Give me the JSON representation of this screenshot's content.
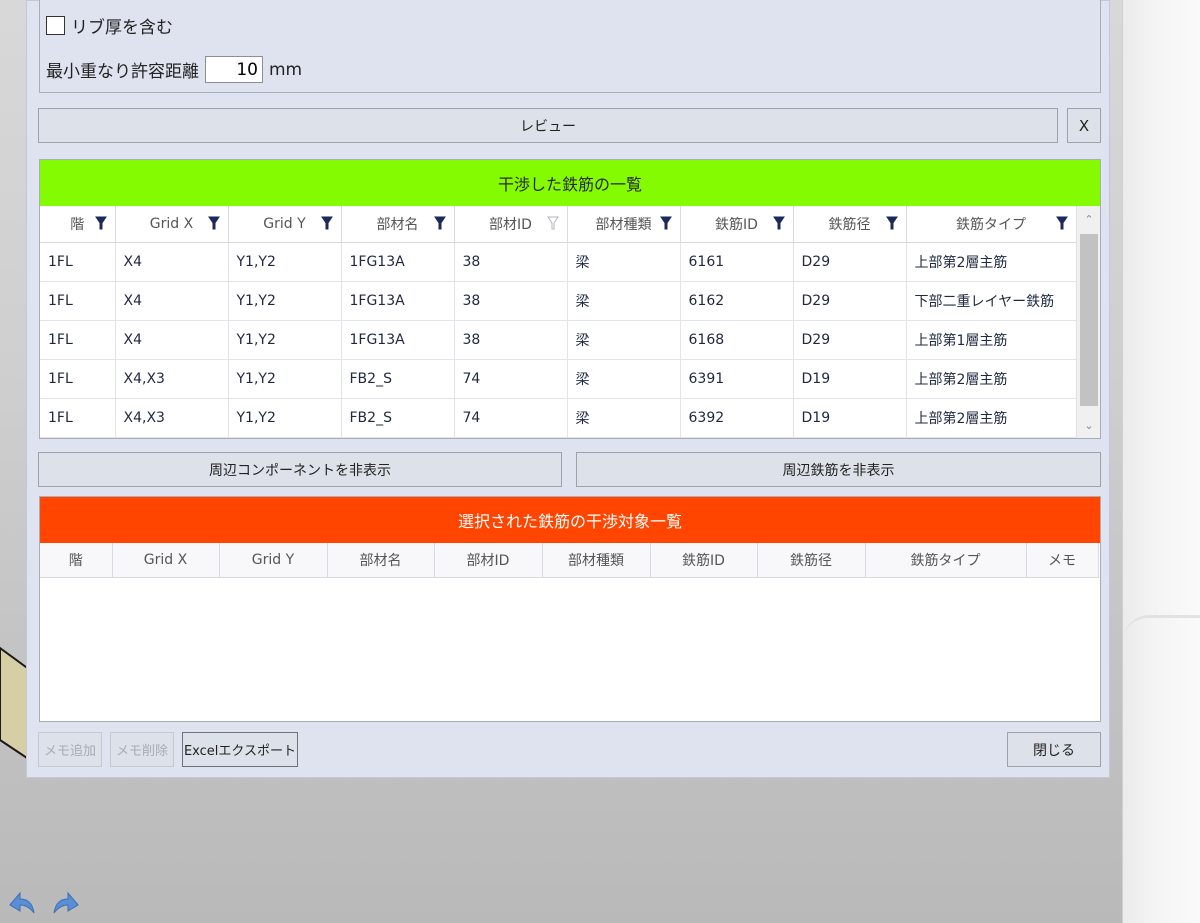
{
  "settings": {
    "rib_checkbox_label": "リブ厚を含む",
    "rib_checked": false,
    "min_distance_label": "最小重なり許容距離",
    "min_distance_value": "10",
    "min_distance_unit": "mm"
  },
  "review_label": "レビュー",
  "close_x_label": "X",
  "interference": {
    "title": "干渉した鉄筋の一覧",
    "header_color": "#84fb00",
    "columns": [
      "階",
      "Grid X",
      "Grid Y",
      "部材名",
      "部材ID",
      "部材種類",
      "鉄筋ID",
      "鉄筋径",
      "鉄筋タイプ"
    ],
    "rows": [
      [
        "1FL",
        "X4",
        "Y1,Y2",
        "1FG13A",
        "38",
        "梁",
        "6161",
        "D29",
        "上部第2層主筋"
      ],
      [
        "1FL",
        "X4",
        "Y1,Y2",
        "1FG13A",
        "38",
        "梁",
        "6162",
        "D29",
        "下部二重レイヤー鉄筋"
      ],
      [
        "1FL",
        "X4",
        "Y1,Y2",
        "1FG13A",
        "38",
        "梁",
        "6168",
        "D29",
        "上部第1層主筋"
      ],
      [
        "1FL",
        "X4,X3",
        "Y1,Y2",
        "FB2_S",
        "74",
        "梁",
        "6391",
        "D19",
        "上部第2層主筋"
      ],
      [
        "1FL",
        "X4,X3",
        "Y1,Y2",
        "FB2_S",
        "74",
        "梁",
        "6392",
        "D19",
        "上部第2層主筋"
      ]
    ]
  },
  "hide_components_label": "周辺コンポーネントを非表示",
  "hide_rebar_label": "周辺鉄筋を非表示",
  "targets": {
    "title": "選択された鉄筋の干渉対象一覧",
    "header_color": "#ff4500",
    "columns": [
      "階",
      "Grid X",
      "Grid Y",
      "部材名",
      "部材ID",
      "部材種類",
      "鉄筋ID",
      "鉄筋径",
      "鉄筋タイプ",
      "メモ"
    ]
  },
  "footer": {
    "memo_add_label": "メモ追加",
    "memo_delete_label": "メモ削除",
    "excel_export_label": "Excelエクスポート",
    "close_label": "閉じる"
  },
  "icons": {
    "filter": "filter-icon",
    "undo": "undo-arrow-icon",
    "redo": "redo-arrow-icon"
  }
}
